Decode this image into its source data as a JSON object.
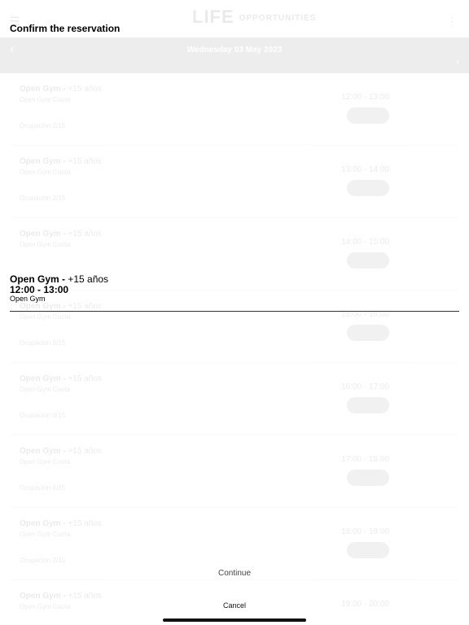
{
  "background": {
    "logo": "LIFE",
    "logo_sub": "OPPORTUNITIES",
    "date_title": "Wednesday 03 May 2023",
    "date_sub": "",
    "rows": [
      {
        "title": "Open Gym",
        "age": "+15 años",
        "sub": "Open Gym Cuota",
        "occupancy": "Ocupación 2/15",
        "time": "12:00 - 13:00"
      },
      {
        "title": "Open Gym",
        "age": "+15 años",
        "sub": "Open Gym Cuota",
        "occupancy": "Ocupación 2/15",
        "time": "13:00 - 14:00"
      },
      {
        "title": "Open Gym",
        "age": "+15 años",
        "sub": "Open Gym Cuota",
        "occupancy": "",
        "time": "14:00 - 15:00"
      },
      {
        "title": "Open Gym",
        "age": "+15 años",
        "sub": "Open Gym Cuota",
        "occupancy": "Ocupación 0/15",
        "time": "15:00 - 16:00"
      },
      {
        "title": "Open Gym",
        "age": "+15 años",
        "sub": "Open Gym Cuota",
        "occupancy": "Ocupación 0/15",
        "time": "16:00 - 17:00"
      },
      {
        "title": "Open Gym",
        "age": "+15 años",
        "sub": "Open Gym Cuota",
        "occupancy": "Ocupación 0/15",
        "time": "17:00 - 18:00"
      },
      {
        "title": "Open Gym",
        "age": "+15 años",
        "sub": "Open Gym Cuota",
        "occupancy": "Ocupación 0/15",
        "time": "18:00 - 19:00"
      },
      {
        "title": "Open Gym",
        "age": "+15 años",
        "sub": "Open Gym Cuota",
        "occupancy": "",
        "time": "19:00 - 20:00"
      }
    ]
  },
  "sheet": {
    "title": "Confirm the reservation",
    "class_name": "Open Gym -",
    "class_age": " +15 años",
    "class_time": "12:00 - 13:00",
    "class_subtitle": "Open Gym",
    "continue_label": "Continue",
    "cancel_label": "Cancel"
  }
}
